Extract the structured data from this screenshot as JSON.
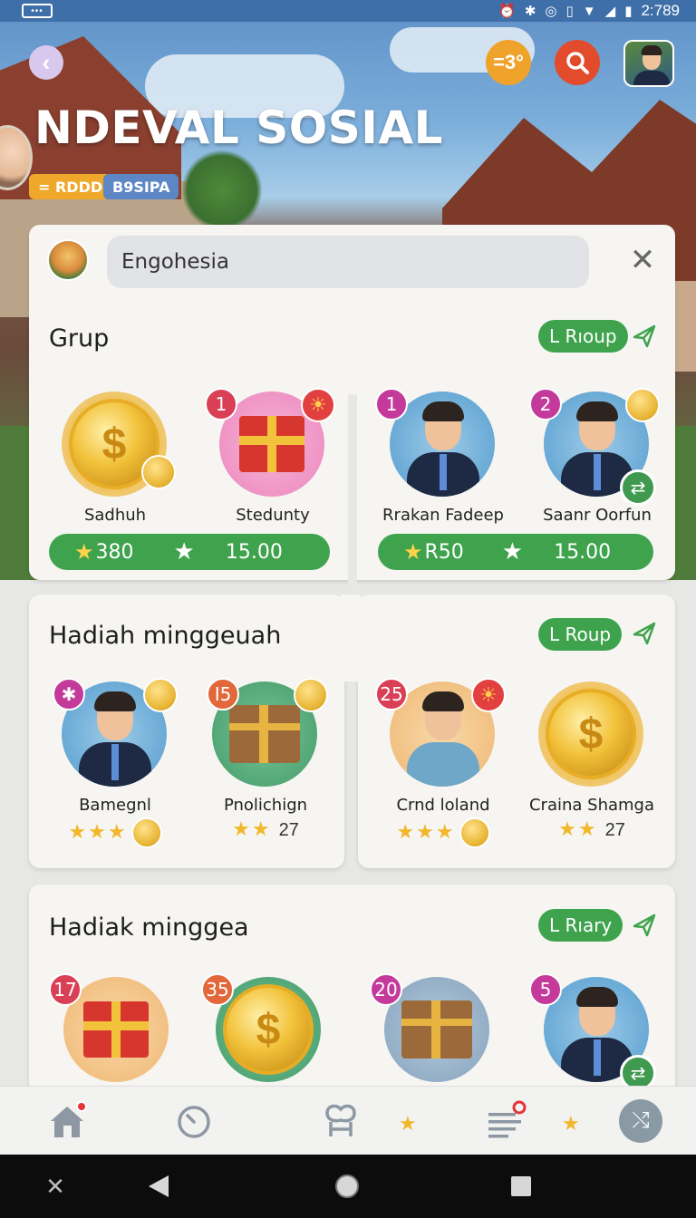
{
  "status_bar": {
    "time": "2:789"
  },
  "header": {
    "title": "NDEVAL SOSIAL",
    "badge_label": "=3°",
    "chips": [
      "= RDDD",
      "B9SIPA"
    ]
  },
  "search": {
    "value": "Engohesia"
  },
  "sections": [
    {
      "title": "Grup",
      "action_label": "L Rıoup",
      "items": [
        {
          "name": "Sadhuh",
          "number": ""
        },
        {
          "name": "Stedunty",
          "number": "1"
        },
        {
          "name": "Rrakan Fadeep",
          "number": "1"
        },
        {
          "name": "Saanr Oorfun",
          "number": "2"
        }
      ],
      "bars": [
        {
          "left_value": "380",
          "right_value": "15.00"
        },
        {
          "left_value": "R50",
          "right_value": "15.00"
        }
      ]
    },
    {
      "title": "Hadiah minggeuah",
      "action_label": "L Roup",
      "items": [
        {
          "name": "Bamegnl",
          "number": "✱",
          "rating": ""
        },
        {
          "name": "Pnolichign",
          "number": "I5",
          "rating": "27"
        },
        {
          "name": "Crnd loland",
          "number": "25",
          "rating": ""
        },
        {
          "name": "Craina Shamga",
          "number": "",
          "rating": "27"
        }
      ]
    },
    {
      "title": "Hadiak minggea",
      "action_label": "L Rıary",
      "items": [
        {
          "number": "17"
        },
        {
          "number": "35"
        },
        {
          "number": "20"
        },
        {
          "number": "5"
        }
      ]
    }
  ],
  "icons": {
    "back": "chevron-left-icon",
    "search": "search-icon",
    "close": "close-icon",
    "share": "share-icon",
    "nav": [
      "home-icon",
      "clock-icon",
      "friends-icon",
      "list-icon",
      "shuffle-icon"
    ]
  },
  "colors": {
    "accent_green": "#3fa34d",
    "badge_orange": "#f0a32a",
    "search_red": "#e24b2c",
    "star": "#f2b72b"
  }
}
